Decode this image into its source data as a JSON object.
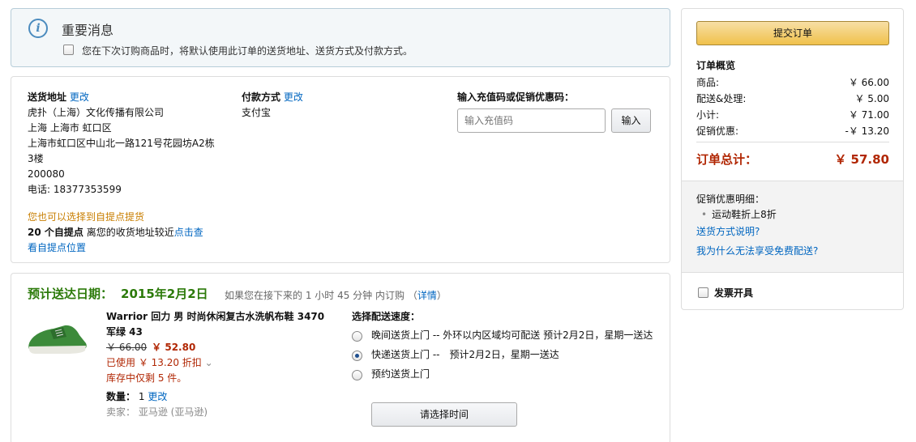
{
  "notice": {
    "title": "重要消息",
    "checkbox_label": "您在下次订购商品时，将默认使用此订单的送货地址、送货方式及付款方式。"
  },
  "shipping": {
    "label": "送货地址",
    "change": "更改",
    "lines": [
      "虎扑（上海）文化传播有限公司",
      "上海 上海市 虹口区",
      "上海市虹口区中山北一路121号花园坊A2栋",
      "3楼",
      "200080",
      "电话: 18377353599"
    ]
  },
  "payment": {
    "label": "付款方式",
    "change": "更改",
    "method": "支付宝"
  },
  "promo": {
    "label": "输入充值码或促销优惠码：",
    "placeholder": "输入充值码",
    "button": "输入"
  },
  "pickup": {
    "line1": "您也可以选择到自提点提货",
    "count": "20 个自提点",
    "line2_rest": "离您的收货地址较近",
    "view": "点击查",
    "view2": "看自提点位置"
  },
  "delivery": {
    "est_label": "预计送达日期：",
    "est_date": "2015年2月2日",
    "note": "如果您在接下来的 1 小时 45 分钟 内订购",
    "details_open": "（",
    "details": "详情",
    "details_close": "）",
    "product_name": "Warrior 回力 男 时尚休闲复古水洗帆布鞋 3470 军绿 43",
    "old_price": "￥ 66.00",
    "price": "￥ 52.80",
    "discount": "已使用 ￥ 13.20 折扣",
    "stock": "库存中仅剩 5 件。",
    "qty_label": "数量：",
    "qty": "1",
    "qty_change": "更改",
    "seller_label": "卖家：",
    "seller": "亚马逊 (亚马逊)",
    "speed_title": "选择配送速度：",
    "options": [
      "晚间送货上门 -- 外环以内区域均可配送 预计2月2日，星期一送达",
      "快递送货上门 --　预计2月2日，星期一送达",
      "预约送货上门"
    ],
    "selected_option": 1,
    "time_button": "请选择时间"
  },
  "summary": {
    "submit": "提交订单",
    "overview_title": "订单概览",
    "rows": [
      {
        "label": "商品:",
        "value": "￥ 66.00"
      },
      {
        "label": "配送&处理:",
        "value": "￥ 5.00"
      },
      {
        "label": "小计:",
        "value": "￥ 71.00"
      },
      {
        "label": "促销优惠:",
        "value": "-￥ 13.20"
      }
    ],
    "total_label": "订单总计：",
    "total_value": "￥ 57.80",
    "promo_detail_title": "促销优惠明细：",
    "promo_detail_item": "运动鞋折上8折",
    "link_shipping": "送货方式说明?",
    "link_free": "我为什么无法享受免费配送?",
    "invoice": "发票开具"
  },
  "colors": {
    "link": "#0066c0",
    "price_red": "#b12704",
    "delivery_green": "#2c7a0a",
    "button_yellow": "#f0c14b"
  }
}
